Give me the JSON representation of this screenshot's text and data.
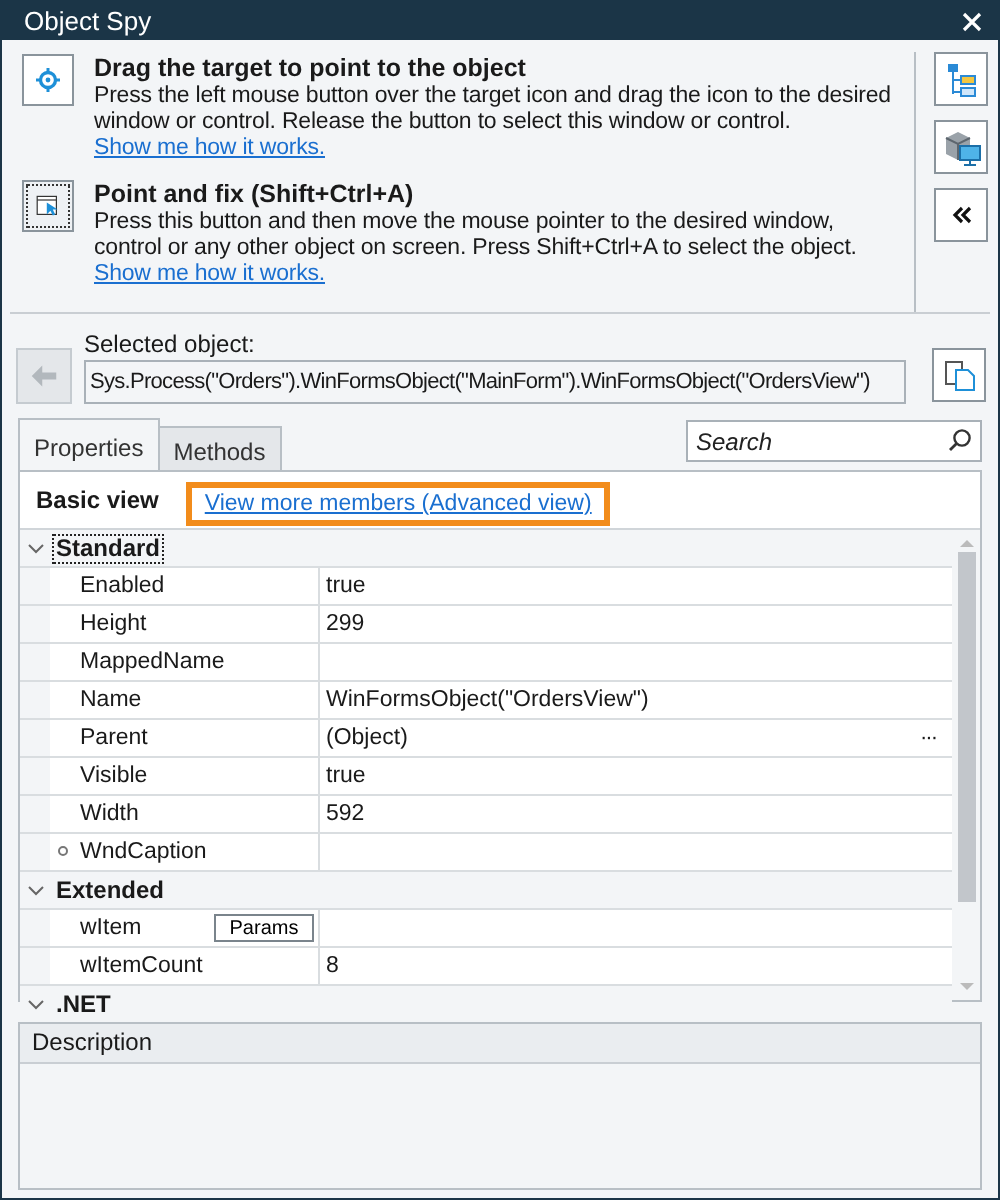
{
  "window": {
    "title": "Object Spy"
  },
  "instructions": [
    {
      "kind": "drag",
      "title": "Drag the target to point to the object",
      "text": "Press the left mouse button over the target icon and drag the icon to the desired window or control. Release the button to select this window or control.",
      "link": "Show me how it works."
    },
    {
      "kind": "point",
      "title": "Point and fix (Shift+Ctrl+A)",
      "text": "Press this button and then move the mouse pointer to the desired window, control or any other object on screen. Press Shift+Ctrl+A to select the object.",
      "link": "Show me how it works."
    }
  ],
  "selected_object": {
    "label": "Selected object:",
    "value": "Sys.Process(\"Orders\").WinFormsObject(\"MainForm\").WinFormsObject(\"OrdersView\")"
  },
  "tabs": [
    {
      "label": "Properties",
      "selected": true
    },
    {
      "label": "Methods",
      "selected": false
    }
  ],
  "search": {
    "placeholder": "Search"
  },
  "view": {
    "label": "Basic view",
    "link": "View more members (Advanced view)",
    "highlighted": true
  },
  "sections": [
    {
      "title": "Standard",
      "expanded": true,
      "selected": true,
      "rows": [
        {
          "name": "Enabled",
          "value": "true"
        },
        {
          "name": "Height",
          "value": "299"
        },
        {
          "name": "MappedName"
        },
        {
          "name": "Name",
          "value": "WinFormsObject(\"OrdersView\")"
        },
        {
          "name": "Parent",
          "value": "(Object)",
          "ellipsis": "···"
        },
        {
          "name": "Visible",
          "value": "true"
        },
        {
          "name": "Width",
          "value": "592"
        },
        {
          "name": "WndCaption",
          "bullet": true
        }
      ]
    },
    {
      "title": "Extended",
      "expanded": true,
      "selected": false,
      "rows": [
        {
          "name": "wItem",
          "button": "Params"
        },
        {
          "name": "wItemCount",
          "value": "8"
        }
      ]
    },
    {
      "title": ".NET",
      "expanded": true,
      "selected": false
    }
  ],
  "description": {
    "title": "Description"
  }
}
